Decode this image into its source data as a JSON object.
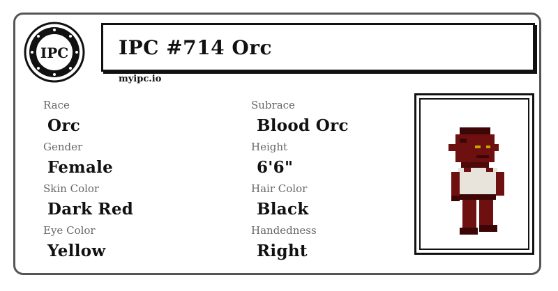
{
  "seal": {
    "text": "IPC"
  },
  "header": {
    "title": "IPC #714 Orc",
    "site": "myipc.io"
  },
  "fields": {
    "race": {
      "label": "Race",
      "value": "Orc"
    },
    "subrace": {
      "label": "Subrace",
      "value": "Blood Orc"
    },
    "gender": {
      "label": "Gender",
      "value": "Female"
    },
    "height": {
      "label": "Height",
      "value": "6'6\""
    },
    "skin_color": {
      "label": "Skin Color",
      "value": "Dark Red"
    },
    "hair_color": {
      "label": "Hair Color",
      "value": "Black"
    },
    "eye_color": {
      "label": "Eye Color",
      "value": "Yellow"
    },
    "handedness": {
      "label": "Handedness",
      "value": "Right"
    }
  },
  "colors": {
    "border": "#555555",
    "ink": "#111111",
    "label": "#666666",
    "skin": "#6e1010",
    "skin_dark": "#3c0606",
    "shirt": "#e8e4dc"
  }
}
